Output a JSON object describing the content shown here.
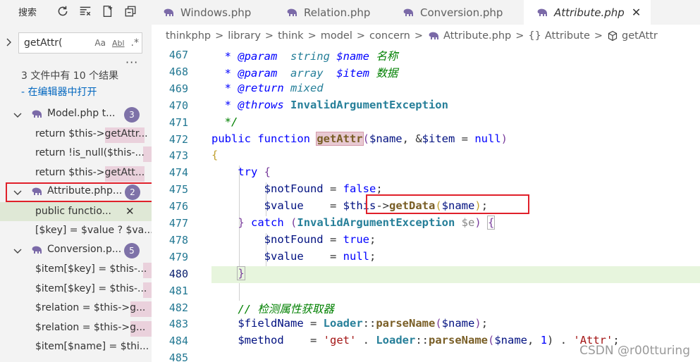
{
  "sidebar": {
    "title": "搜索",
    "tool_icons": [
      "refresh-icon",
      "clear-results-icon",
      "new-search-editor-icon",
      "collapse-all-icon"
    ],
    "search": {
      "value": "getAttr(",
      "options": [
        "Aa",
        "Abl",
        ".*"
      ]
    },
    "more": "···",
    "summary": "3 文件中有 10 个结果",
    "open_in_editor": "- 在编辑器中打开",
    "files": [
      {
        "name": "Model.php  t...",
        "count": "3",
        "matches": [
          {
            "text": "return $this->getAttr..."
          },
          {
            "text": "return !is_null($this-..."
          },
          {
            "text": "return $this->getAtt..."
          }
        ]
      },
      {
        "name": "Attribute.php...",
        "count": "2",
        "matches": [
          {
            "text": "public functio...",
            "close": "✕"
          },
          {
            "text": "[$key] = $value ? $va..."
          }
        ]
      },
      {
        "name": "Conversion.p...",
        "count": "5",
        "matches": [
          {
            "text": "$item[$key] = $this-..."
          },
          {
            "text": "$item[$key] = $this-..."
          },
          {
            "text": "$relation = $this->g..."
          },
          {
            "text": "$relation = $this->g..."
          },
          {
            "text": "$item[$name] = $thi..."
          }
        ]
      }
    ]
  },
  "tabs": [
    {
      "label": "Windows.php"
    },
    {
      "label": "Relation.php"
    },
    {
      "label": "Conversion.php"
    },
    {
      "label": "Attribute.php",
      "close": "✕"
    }
  ],
  "breadcrumb": {
    "parts": [
      "thinkphp",
      "library",
      "think",
      "model",
      "concern"
    ],
    "file": "Attribute.php",
    "class": "Attribute",
    "method": "getAttr",
    "braces": "{}"
  },
  "editor": {
    "line_numbers": [
      "467",
      "468",
      "469",
      "470",
      "471",
      "472",
      "473",
      "474",
      "475",
      "476",
      "477",
      "478",
      "479",
      "480",
      "481",
      "482",
      "483",
      "484",
      "485"
    ],
    "current_line": "480"
  },
  "watermark": "CSDN @r00tturing",
  "colors": {
    "search_badge": "#7e72a8",
    "highlight_box": "#e0202a",
    "current_line_bg": "#e7f5dd"
  }
}
